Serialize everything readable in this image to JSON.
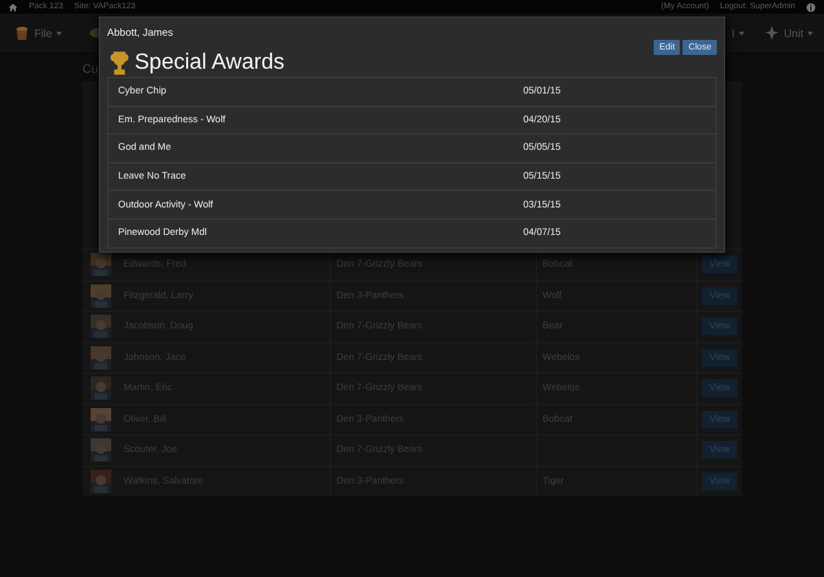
{
  "top_bar": {
    "pack": "Pack 123",
    "site": "Site: VAPack123",
    "account": "(My Account)",
    "logout": "Logout: SuperAdmin"
  },
  "nav": {
    "left": [
      {
        "label": "File",
        "kind": "file"
      },
      {
        "kind": "leaf"
      }
    ],
    "right": [
      {
        "label": "l",
        "kind": "plain"
      },
      {
        "label": "Unit",
        "kind": "unit"
      }
    ]
  },
  "page_heading": "Cu",
  "roster": [
    {
      "name": "Edwards, Fred",
      "den": "Den 7-Grizzly Bears",
      "rank": "Bobcat",
      "action": "View"
    },
    {
      "name": "Fitzgerald, Larry",
      "den": "Den 3-Panthers",
      "rank": "Wolf",
      "action": "View"
    },
    {
      "name": "Jacobson, Doug",
      "den": "Den 7-Grizzly Bears",
      "rank": "Bear",
      "action": "View"
    },
    {
      "name": "Johnson, Jace",
      "den": "Den 7-Grizzly Bears",
      "rank": "Webelos",
      "action": "View"
    },
    {
      "name": "Martin, Eric",
      "den": "Den 7-Grizzly Bears",
      "rank": "Webelos",
      "action": "View"
    },
    {
      "name": "Oliver, Bill",
      "den": "Den 3-Panthers",
      "rank": "Bobcat",
      "action": "View"
    },
    {
      "name": "Scouter, Joe",
      "den": "Den 7-Grizzly Bears",
      "action": "View"
    },
    {
      "name": "Watkins, Salvatore",
      "den": "Den 3-Panthers",
      "rank": "Tiger",
      "action": "View"
    }
  ],
  "modal": {
    "title": "Abbott, James",
    "buttons": [
      "Edit",
      "Close"
    ],
    "heading": "Special Awards",
    "awards": [
      {
        "award": "Cyber Chip",
        "date": "05/01/15"
      },
      {
        "award": "Em. Preparedness - Wolf",
        "date": "04/20/15"
      },
      {
        "award": "God and Me",
        "date": "05/05/15"
      },
      {
        "award": "Leave No Trace",
        "date": "05/15/15"
      },
      {
        "award": "Outdoor Activity - Wolf",
        "date": "03/15/15"
      },
      {
        "award": "Pinewood Derby Mdl",
        "date": "04/07/15"
      }
    ]
  }
}
